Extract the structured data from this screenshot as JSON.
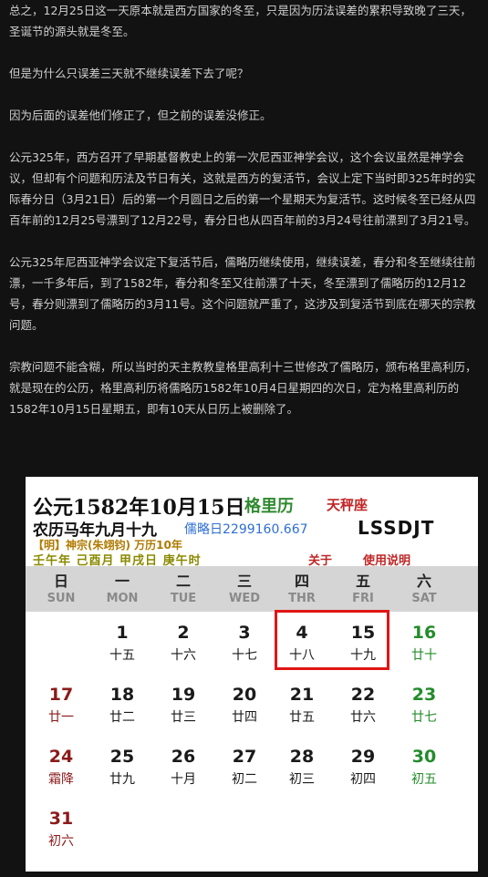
{
  "article": {
    "paragraphs": [
      "总之，12月25日这一天原本就是西方国家的冬至，只是因为历法误差的累积导致晚了三天，圣诞节的源头就是冬至。",
      "但是为什么只误差三天就不继续误差下去了呢？",
      "因为后面的误差他们修正了，但之前的误差没修正。",
      "公元325年，西方召开了早期基督教史上的第一次尼西亚神学会议，这个会议虽然是神学会议，但却有个问题和历法及节日有关，这就是西方的复活节，会议上定下当时即325年时的实际春分日（3月21日）后的第一个月圆日之后的第一个星期天为复活节。这时候冬至已经从四百年前的12月25号漂到了12月22号，春分日也从四百年前的3月24号往前漂到了3月21号。",
      "公元325年尼西亚神学会议定下复活节后，儒略历继续使用，继续误差，春分和冬至继续往前漂，一千多年后，到了1582年，春分和冬至又往前漂了十天，冬至漂到了儒略历的12月12号，春分则漂到了儒略历的3月11号。这个问题就严重了，这涉及到复活节到底在哪天的宗教问题。",
      "宗教问题不能含糊，所以当时的天主教教皇格里高利十三世修改了儒略历，颁布格里高利历，就是现在的公历，格里高利历将儒略历1582年10月4日星期四的次日，定为格里高利历的1582年10月15日星期五，即有10天从日历上被删除了。"
    ]
  },
  "calendar": {
    "date_title": "公元1582年10月15日",
    "calendar_name": "格里历",
    "zodiac": "天秤座",
    "lunar_date": "农历马年九月十九",
    "julian_day": "儒略日2299160.667",
    "code": "LSSDJT",
    "era": "【明】神宗(朱翊钧) 万历10年",
    "ganzhi": "壬午年 己酉月 甲戌日 庚午时",
    "about_label": "关于",
    "help_label": "使用说明",
    "highlight_color": "#e01515",
    "weekdays": [
      {
        "cn": "日",
        "en": "SUN"
      },
      {
        "cn": "一",
        "en": "MON"
      },
      {
        "cn": "二",
        "en": "TUE"
      },
      {
        "cn": "三",
        "en": "WED"
      },
      {
        "cn": "四",
        "en": "THR"
      },
      {
        "cn": "五",
        "en": "FRI"
      },
      {
        "cn": "六",
        "en": "SAT"
      }
    ],
    "weeks": [
      [
        null,
        {
          "day": "1",
          "lunar": "十五"
        },
        {
          "day": "2",
          "lunar": "十六"
        },
        {
          "day": "3",
          "lunar": "十七"
        },
        {
          "day": "4",
          "lunar": "十八"
        },
        {
          "day": "15",
          "lunar": "十九"
        },
        {
          "day": "16",
          "lunar": "廿十"
        }
      ],
      [
        {
          "day": "17",
          "lunar": "廿一"
        },
        {
          "day": "18",
          "lunar": "廿二"
        },
        {
          "day": "19",
          "lunar": "廿三"
        },
        {
          "day": "20",
          "lunar": "廿四"
        },
        {
          "day": "21",
          "lunar": "廿五"
        },
        {
          "day": "22",
          "lunar": "廿六"
        },
        {
          "day": "23",
          "lunar": "廿七"
        }
      ],
      [
        {
          "day": "24",
          "lunar": "霜降"
        },
        {
          "day": "25",
          "lunar": "廿九"
        },
        {
          "day": "26",
          "lunar": "十月"
        },
        {
          "day": "27",
          "lunar": "初二"
        },
        {
          "day": "28",
          "lunar": "初三"
        },
        {
          "day": "29",
          "lunar": "初四"
        },
        {
          "day": "30",
          "lunar": "初五"
        }
      ],
      [
        {
          "day": "31",
          "lunar": "初六"
        },
        null,
        null,
        null,
        null,
        null,
        null
      ]
    ]
  }
}
